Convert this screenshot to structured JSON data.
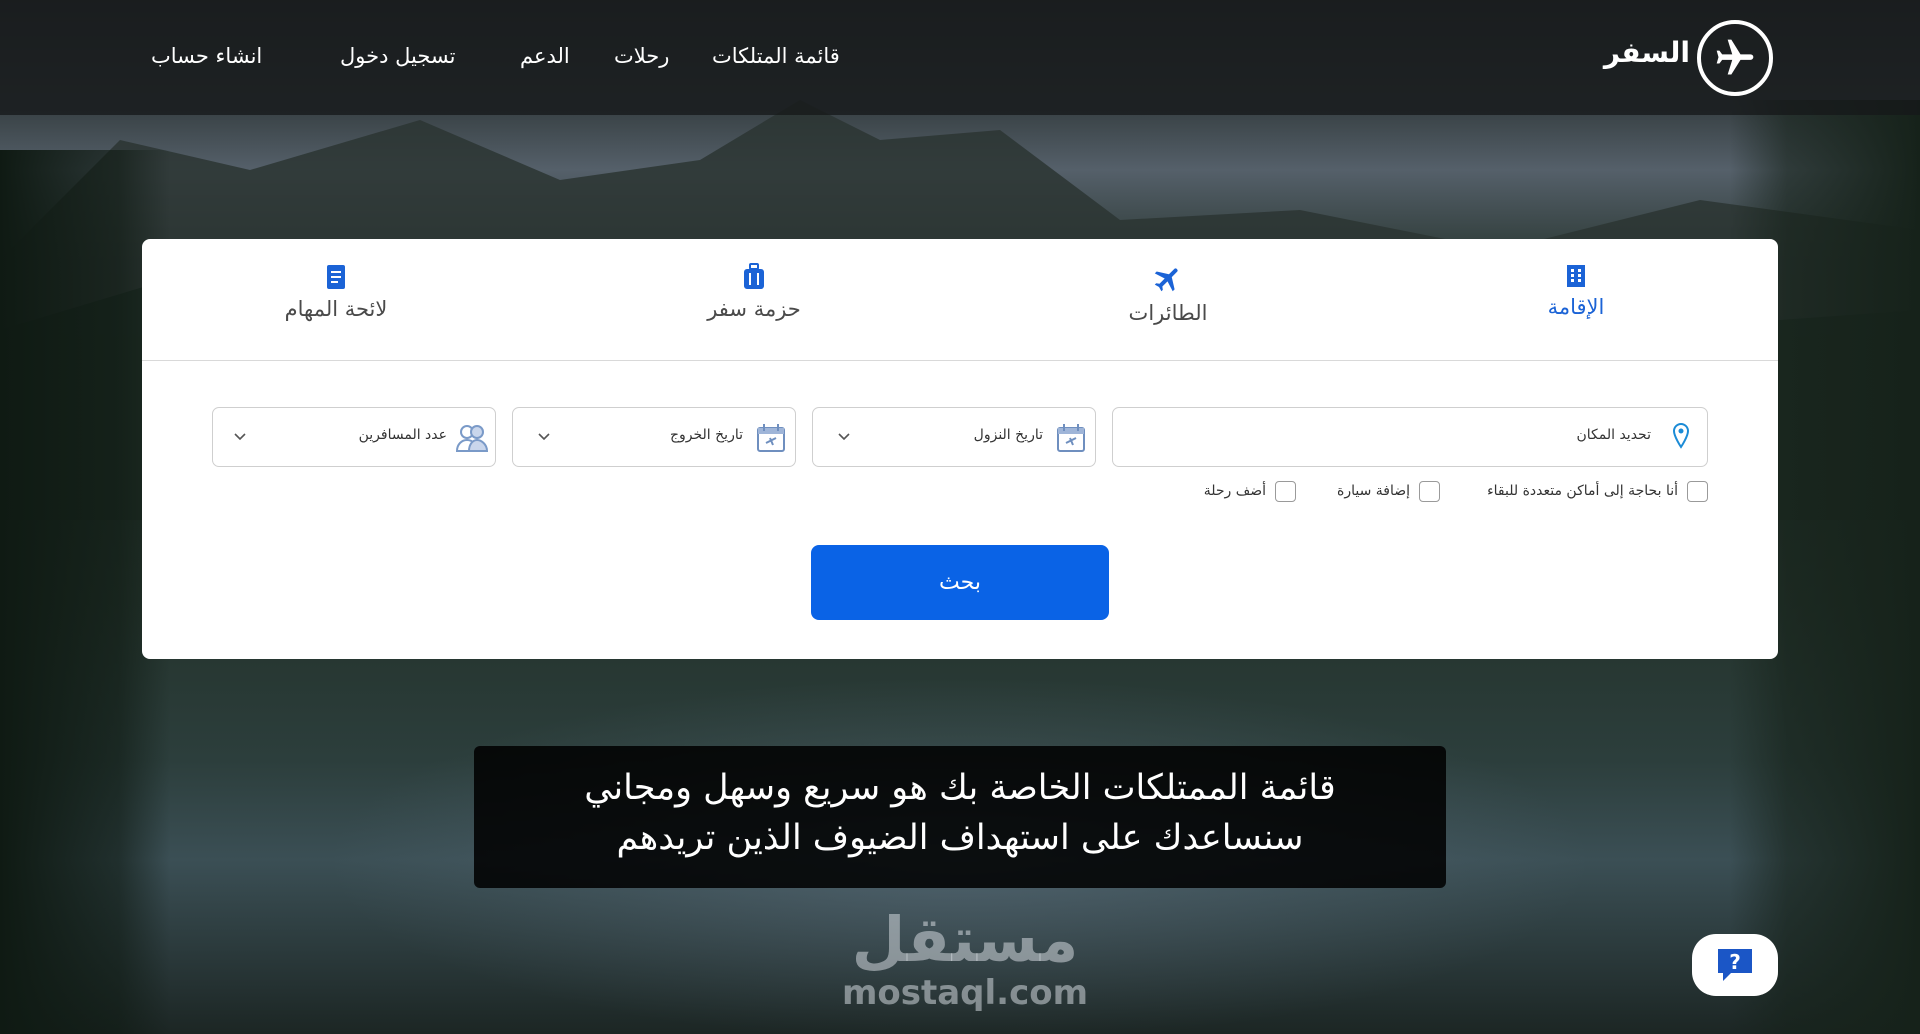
{
  "header": {
    "logo_text": "السفر",
    "logo_icon": "airplane-icon",
    "nav": {
      "properties": "قائمة المتلكات",
      "trips": "رحلات",
      "support": "الدعم",
      "login": "تسجيل دخول",
      "signup": "انشاء حساب"
    }
  },
  "tabs": {
    "stays": "الإقامة",
    "flights": "الطائرات",
    "packages": "حزمة سفر",
    "tasks": "لائحة المهام"
  },
  "form": {
    "location": "تحديد المكان",
    "checkin": "تاريخ النزول",
    "checkout": "تاريخ الخروج",
    "guests": "عدد المسافرين",
    "check_multi": "أنا بحاجة إلى أماكن متعددة للبقاء",
    "check_car": "إضافة سيارة",
    "check_flight": "أضف رحلة",
    "search": "بحث"
  },
  "tagline": {
    "line1": "قائمة الممتلكات الخاصة بك هو سريع وسهل ومجاني",
    "line2": "سنساعدك على استهداف الضيوف الذين تريدهم"
  },
  "watermark": {
    "arabic": "مستقل",
    "latin": "mostaql.com"
  },
  "colors": {
    "accent": "#0a63e6",
    "active_tab": "#1b63d6"
  }
}
